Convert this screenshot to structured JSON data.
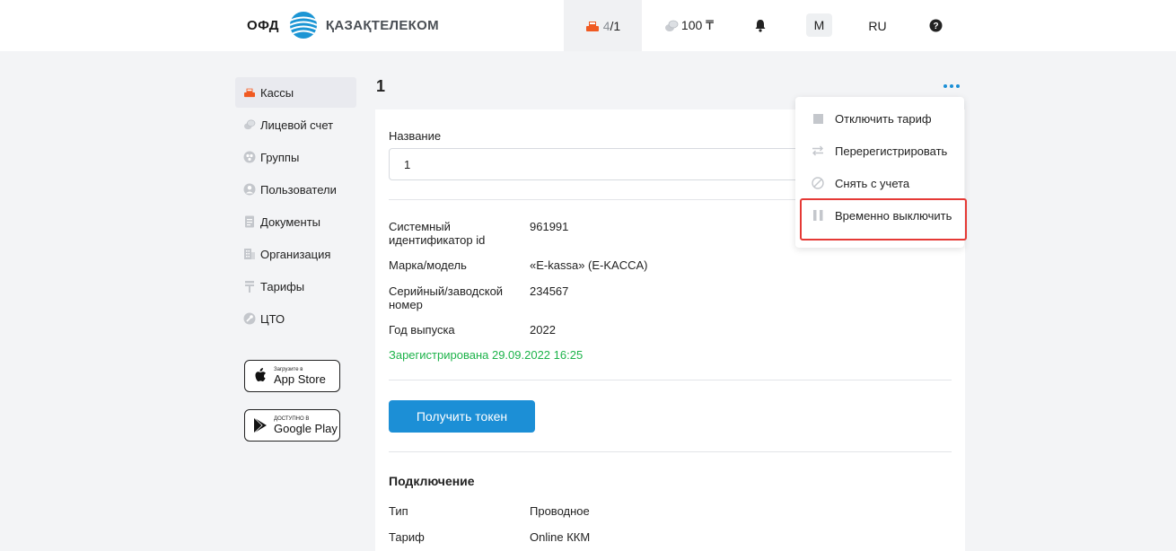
{
  "header": {
    "logo_ofd": "ОФД",
    "logo_company": "ҚАЗАҚТЕЛЕКОМ",
    "kassa_count_a": "4",
    "kassa_count_b": "/1",
    "balance": "100 ₸",
    "avatar_letter": "M",
    "language": "RU"
  },
  "sidebar": {
    "items": [
      {
        "label": "Кассы",
        "icon": "cash-register-icon",
        "active": true
      },
      {
        "label": "Лицевой счет",
        "icon": "coins-icon"
      },
      {
        "label": "Группы",
        "icon": "groups-icon"
      },
      {
        "label": "Пользователи",
        "icon": "user-icon"
      },
      {
        "label": "Документы",
        "icon": "document-icon"
      },
      {
        "label": "Организация",
        "icon": "building-icon"
      },
      {
        "label": "Тарифы",
        "icon": "tariff-icon"
      },
      {
        "label": "ЦТО",
        "icon": "wrench-icon"
      }
    ],
    "app_store": {
      "small": "Загрузите в",
      "big": "App Store"
    },
    "google_play": {
      "small": "ДОСТУПНО В",
      "big": "Google Play"
    }
  },
  "main": {
    "title": "1",
    "name_label": "Название",
    "name_value": "1",
    "details": [
      {
        "label": "Системный идентификатор id",
        "value": "961991"
      },
      {
        "label": "Марка/модель",
        "value": "«E-kassa» (E-KACCA)"
      },
      {
        "label": "Серийный/заводской номер",
        "value": "234567"
      },
      {
        "label": "Год выпуска",
        "value": "2022"
      }
    ],
    "registered": "Зарегистрирована 29.09.2022 16:25",
    "token_button": "Получить токен",
    "connection_heading": "Подключение",
    "connection": [
      {
        "label": "Тип",
        "value": "Проводное"
      },
      {
        "label": "Тариф",
        "value": "Online ККМ"
      }
    ]
  },
  "menu": {
    "items": [
      {
        "label": "Отключить тариф",
        "icon": "square-icon"
      },
      {
        "label": "Перерегистрировать",
        "icon": "swap-arrows-icon"
      },
      {
        "label": "Снять с учета",
        "icon": "ban-icon"
      },
      {
        "label": "Временно выключить",
        "icon": "pause-icon"
      }
    ]
  },
  "colors": {
    "accent": "#1c8fd6",
    "success": "#1db34a",
    "highlight": "#e53935",
    "kassa_icon": "#f05a22"
  }
}
